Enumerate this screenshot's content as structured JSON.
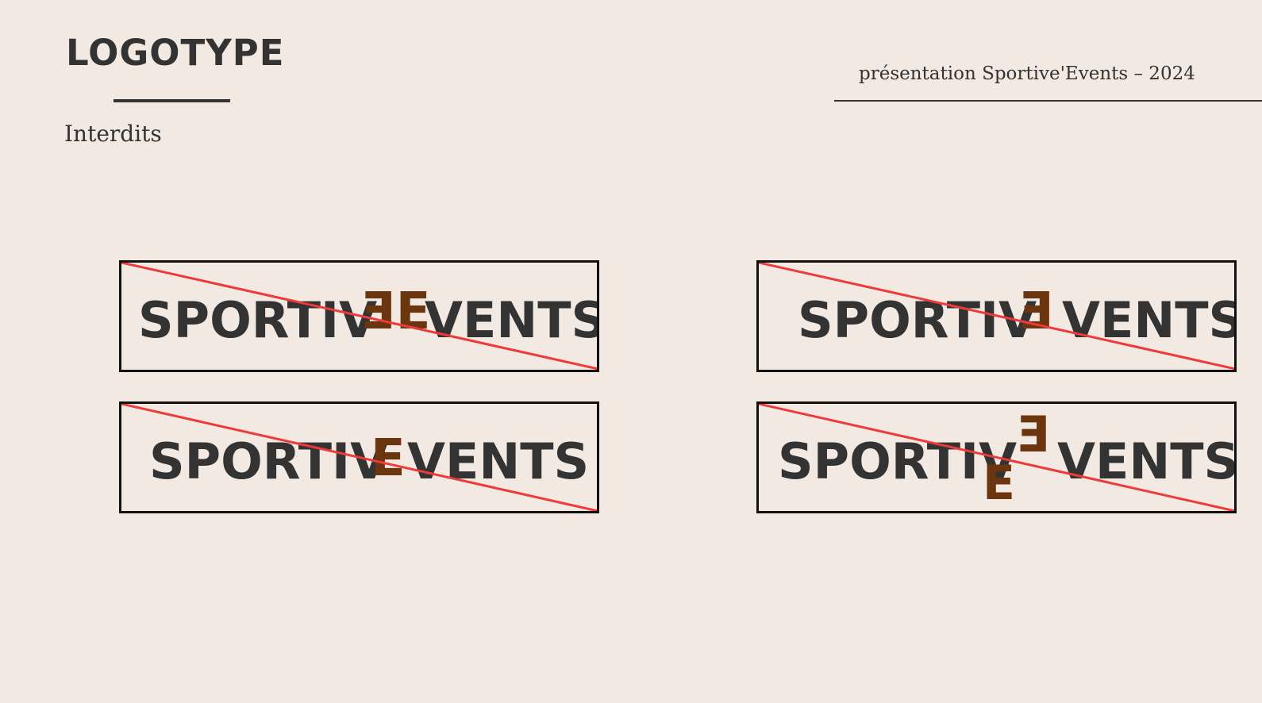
{
  "page": {
    "title": "LOGOTYPE",
    "subtitle": "Interdits",
    "header": "présentation Sportive'Events – 2024"
  },
  "logos": [
    {
      "prefix": "SPORTIV",
      "accent": "EE",
      "suffix": "VENTS",
      "issue": "doubled E"
    },
    {
      "prefix": "SPORTIV",
      "accent": "E",
      "suffix": "VENTS",
      "issue": "mirrored E"
    },
    {
      "prefix": "SPORTIV",
      "accent": "E",
      "suffix": "VENTS",
      "issue": "unstyled E"
    },
    {
      "prefix": "SPORTIV",
      "accent": "EE",
      "suffix": "VENTS",
      "issue": "misplaced E"
    }
  ],
  "colors": {
    "background": "#f2e9e3",
    "text": "#333333",
    "accent": "#6b3510",
    "strike": "#ee3a3a",
    "frame": "#111111"
  }
}
